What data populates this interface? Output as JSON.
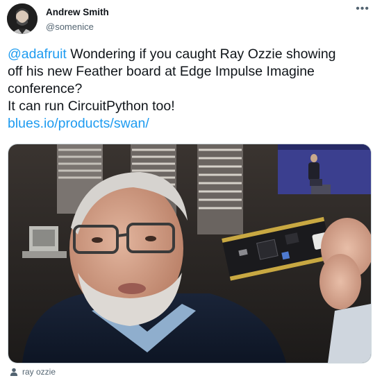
{
  "author": {
    "name": "Andrew Smith",
    "handle": "@somenice"
  },
  "menu_icon": "more-dots-icon",
  "menu_glyph": "•••",
  "tweet": {
    "mention": "@adafruit",
    "line1_rest": " Wondering if you caught Ray Ozzie showing",
    "line2": "off his new Feather board at Edge Impulse Imagine",
    "line3": "conference?",
    "line4": "It can run CircuitPython too!",
    "link": "blues.io/products/swan/"
  },
  "media": {
    "tagged_person": "ray ozzie",
    "tag_icon": "person-icon"
  },
  "colors": {
    "link": "#1d9bf0",
    "secondary_text": "#536471",
    "primary_text": "#0f1419"
  }
}
